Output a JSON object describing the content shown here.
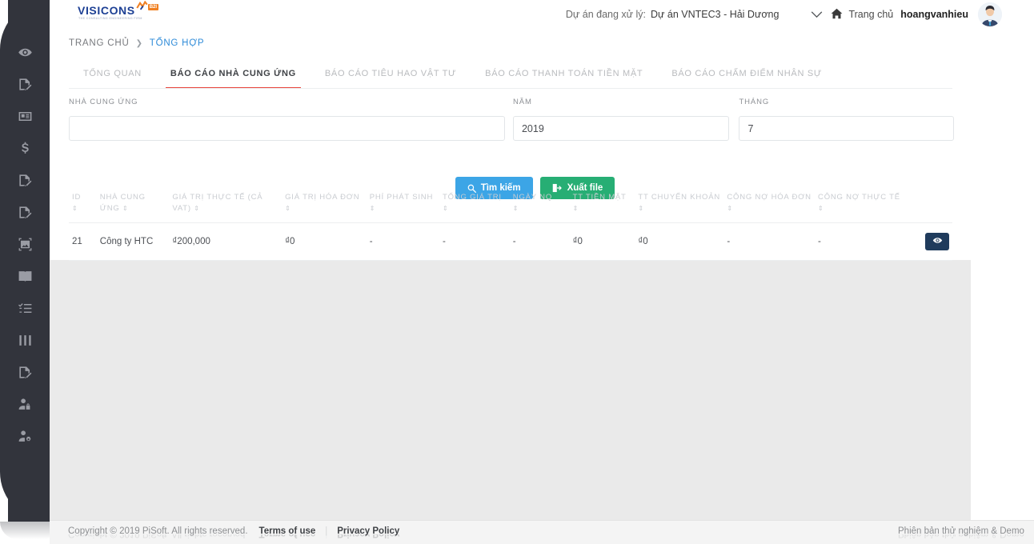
{
  "brand": {
    "logo_text": "VISICONS",
    "logo_tagline": "THE CONSULTING ENGINEERING FIRM",
    "logo_badge": "B2I",
    "logo_color": "#1c3f94",
    "accent_color": "#f08022"
  },
  "topbar": {
    "project_label": "Dự án đang xử lý:",
    "project_name": "Dự án VNTEC3 - Hải Dương",
    "chevron_icon": "chevron-down-icon",
    "home_icon": "home-icon",
    "home_label": "Trang chủ",
    "user_name": "hoangvanhieu",
    "avatar_icon": "user-avatar"
  },
  "sidebar": {
    "items": [
      {
        "icon": "eye-icon",
        "name": "sidebar-item-overview"
      },
      {
        "icon": "document-edit-icon",
        "name": "sidebar-item-report-1"
      },
      {
        "icon": "id-card-icon",
        "name": "sidebar-item-id-card"
      },
      {
        "icon": "dollar-icon",
        "name": "sidebar-item-finance"
      },
      {
        "icon": "document-edit-icon",
        "name": "sidebar-item-report-2"
      },
      {
        "icon": "document-edit-icon",
        "name": "sidebar-item-report-3"
      },
      {
        "icon": "image-frame-icon",
        "name": "sidebar-item-drawings"
      },
      {
        "icon": "book-icon",
        "name": "sidebar-item-library"
      },
      {
        "icon": "checklist-icon",
        "name": "sidebar-item-tasks"
      },
      {
        "icon": "bar-chart-icon",
        "name": "sidebar-item-statistics"
      },
      {
        "icon": "document-edit-icon",
        "name": "sidebar-item-report-4"
      },
      {
        "icon": "user-lock-icon",
        "name": "sidebar-item-permissions"
      },
      {
        "icon": "user-gear-icon",
        "name": "sidebar-item-user-settings"
      }
    ]
  },
  "breadcrumb": {
    "root": "TRANG CHỦ",
    "separator": "❯",
    "current": "TỔNG HỢP",
    "current_color": "#2e8bd8"
  },
  "tabs": [
    {
      "label": "TỔNG QUAN",
      "active": false
    },
    {
      "label": "BÁO CÁO NHÀ CUNG ỨNG",
      "active": true
    },
    {
      "label": "BÁO CÁO TIÊU HAO VẬT TƯ",
      "active": false
    },
    {
      "label": "BÁO CÁO THANH TOÁN TIỀN MẶT",
      "active": false
    },
    {
      "label": "BÁO CÁO CHẤM ĐIỂM NHÂN SỰ",
      "active": false
    }
  ],
  "active_tab_underline_color": "#e8453c",
  "filters": {
    "supplier": {
      "label": "NHÀ CUNG ỨNG",
      "value": "",
      "placeholder": ""
    },
    "year": {
      "label": "NĂM",
      "value": "2019",
      "placeholder": ""
    },
    "month": {
      "label": "THÁNG",
      "value": "7",
      "placeholder": ""
    }
  },
  "buttons": {
    "search": {
      "label": "Tìm kiếm",
      "icon": "search-icon",
      "color": "#3ca5e6"
    },
    "export": {
      "label": "Xuất file",
      "icon": "export-file-icon",
      "color": "#27ae74"
    }
  },
  "table": {
    "sort_glyph": "⇕",
    "columns": [
      "ID",
      "NHÀ CUNG ỨNG",
      "GIÁ TRỊ THỰC TẾ (CẢ VAT)",
      "GIÁ TRỊ HÓA ĐƠN",
      "PHÍ PHÁT SINH",
      "TỔNG GIÁ TRỊ",
      "NGÀY NQ",
      "TT TIỀN MẶT",
      "TT CHUYỂN KHOẢN",
      "CÔNG NỢ HÓA ĐƠN",
      "CÔNG NỢ THỰC TẾ"
    ],
    "rows": [
      {
        "id": "21",
        "supplier": "Công ty HTC",
        "real_value": "₫200,000",
        "invoice_value": "₫0",
        "extra_fee": "-",
        "total_value": "-",
        "nq_date": "-",
        "cash_payment": "₫0",
        "bank_payment": "₫0",
        "invoice_debt": "-",
        "real_debt": "-",
        "action_icon": "eye-icon"
      }
    ]
  },
  "footer": {
    "copyright": "Copyright © 2019 PiSoft. All rights reserved.",
    "terms": "Terms of use",
    "privacy": "Privacy Policy",
    "version_note": "Phiên bản thử nghiệm & Demo"
  }
}
